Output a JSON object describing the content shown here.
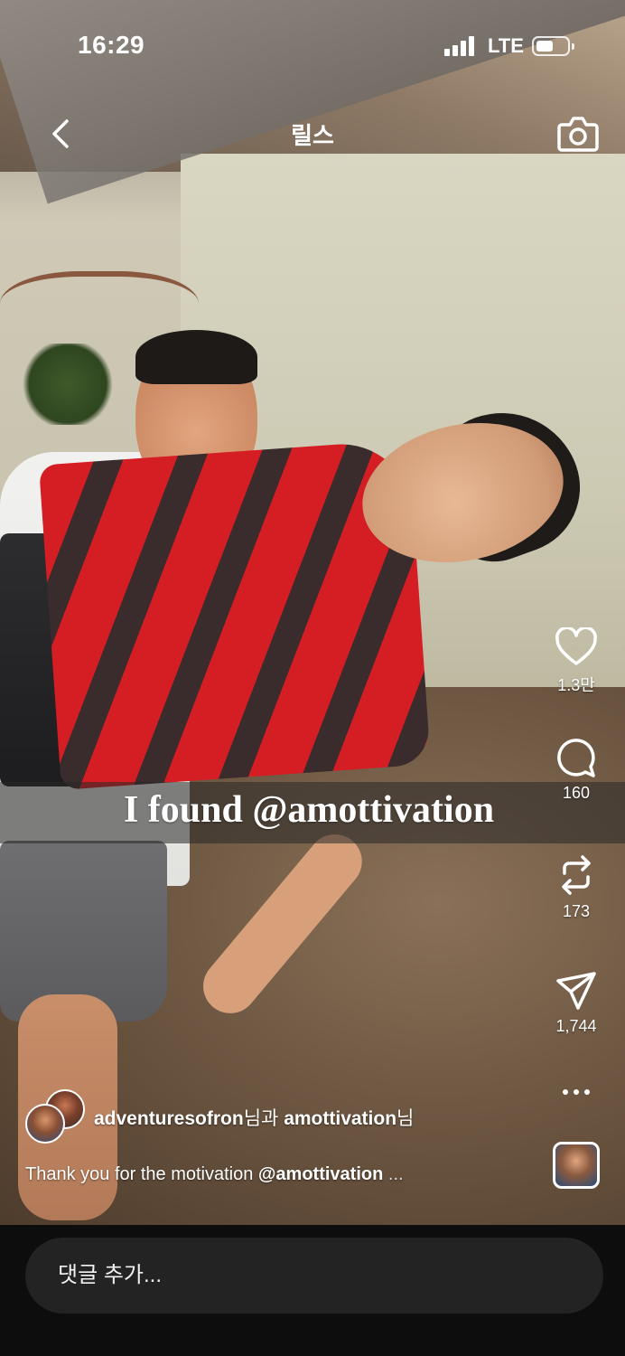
{
  "status_bar": {
    "time": "16:29",
    "carrier": "LTE",
    "battery_level": 0.55
  },
  "header": {
    "back_icon": "chevron-left-icon",
    "title": "릴스",
    "camera_icon": "camera-icon"
  },
  "video": {
    "caption_overlay": "I found @amottivation"
  },
  "actions": {
    "likes": "1.3만",
    "comments": "160",
    "reposts": "173",
    "shares": "1,744",
    "more_icon": "more-horizontal-icon"
  },
  "post": {
    "author_primary": "adventuresofron",
    "author_suffix_1": "님과 ",
    "author_secondary": "amottivation",
    "author_suffix_2": "님",
    "caption_prefix": "Thank you for the motivation ",
    "caption_mention": "@amottivation",
    "caption_more": " ..."
  },
  "comment": {
    "placeholder": "댓글 추가..."
  }
}
